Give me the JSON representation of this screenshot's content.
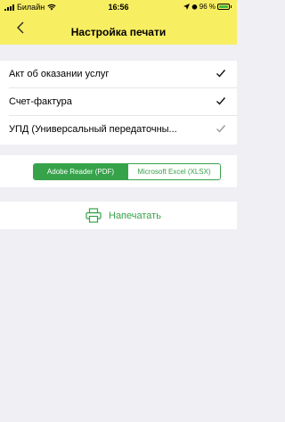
{
  "status_bar": {
    "carrier": "Билайн",
    "time": "16:56",
    "battery": "96 %",
    "battery_level": 0.96
  },
  "header": {
    "title": "Настройка печати"
  },
  "documents": [
    {
      "label": "Акт об оказании услуг",
      "checked": true
    },
    {
      "label": "Счет-фактура",
      "checked": true
    },
    {
      "label": "УПД (Универсальный передаточны...",
      "checked": true
    }
  ],
  "format": {
    "options": [
      "Adobe Reader (PDF)",
      "Microsoft Excel (XLSX)"
    ],
    "selected": "Adobe Reader (PDF)"
  },
  "print": {
    "label": "Напечатать",
    "icon": "printer-icon"
  },
  "colors": {
    "header_bg": "#f8ee62",
    "accent": "#36a34a",
    "background": "#efeff4"
  }
}
